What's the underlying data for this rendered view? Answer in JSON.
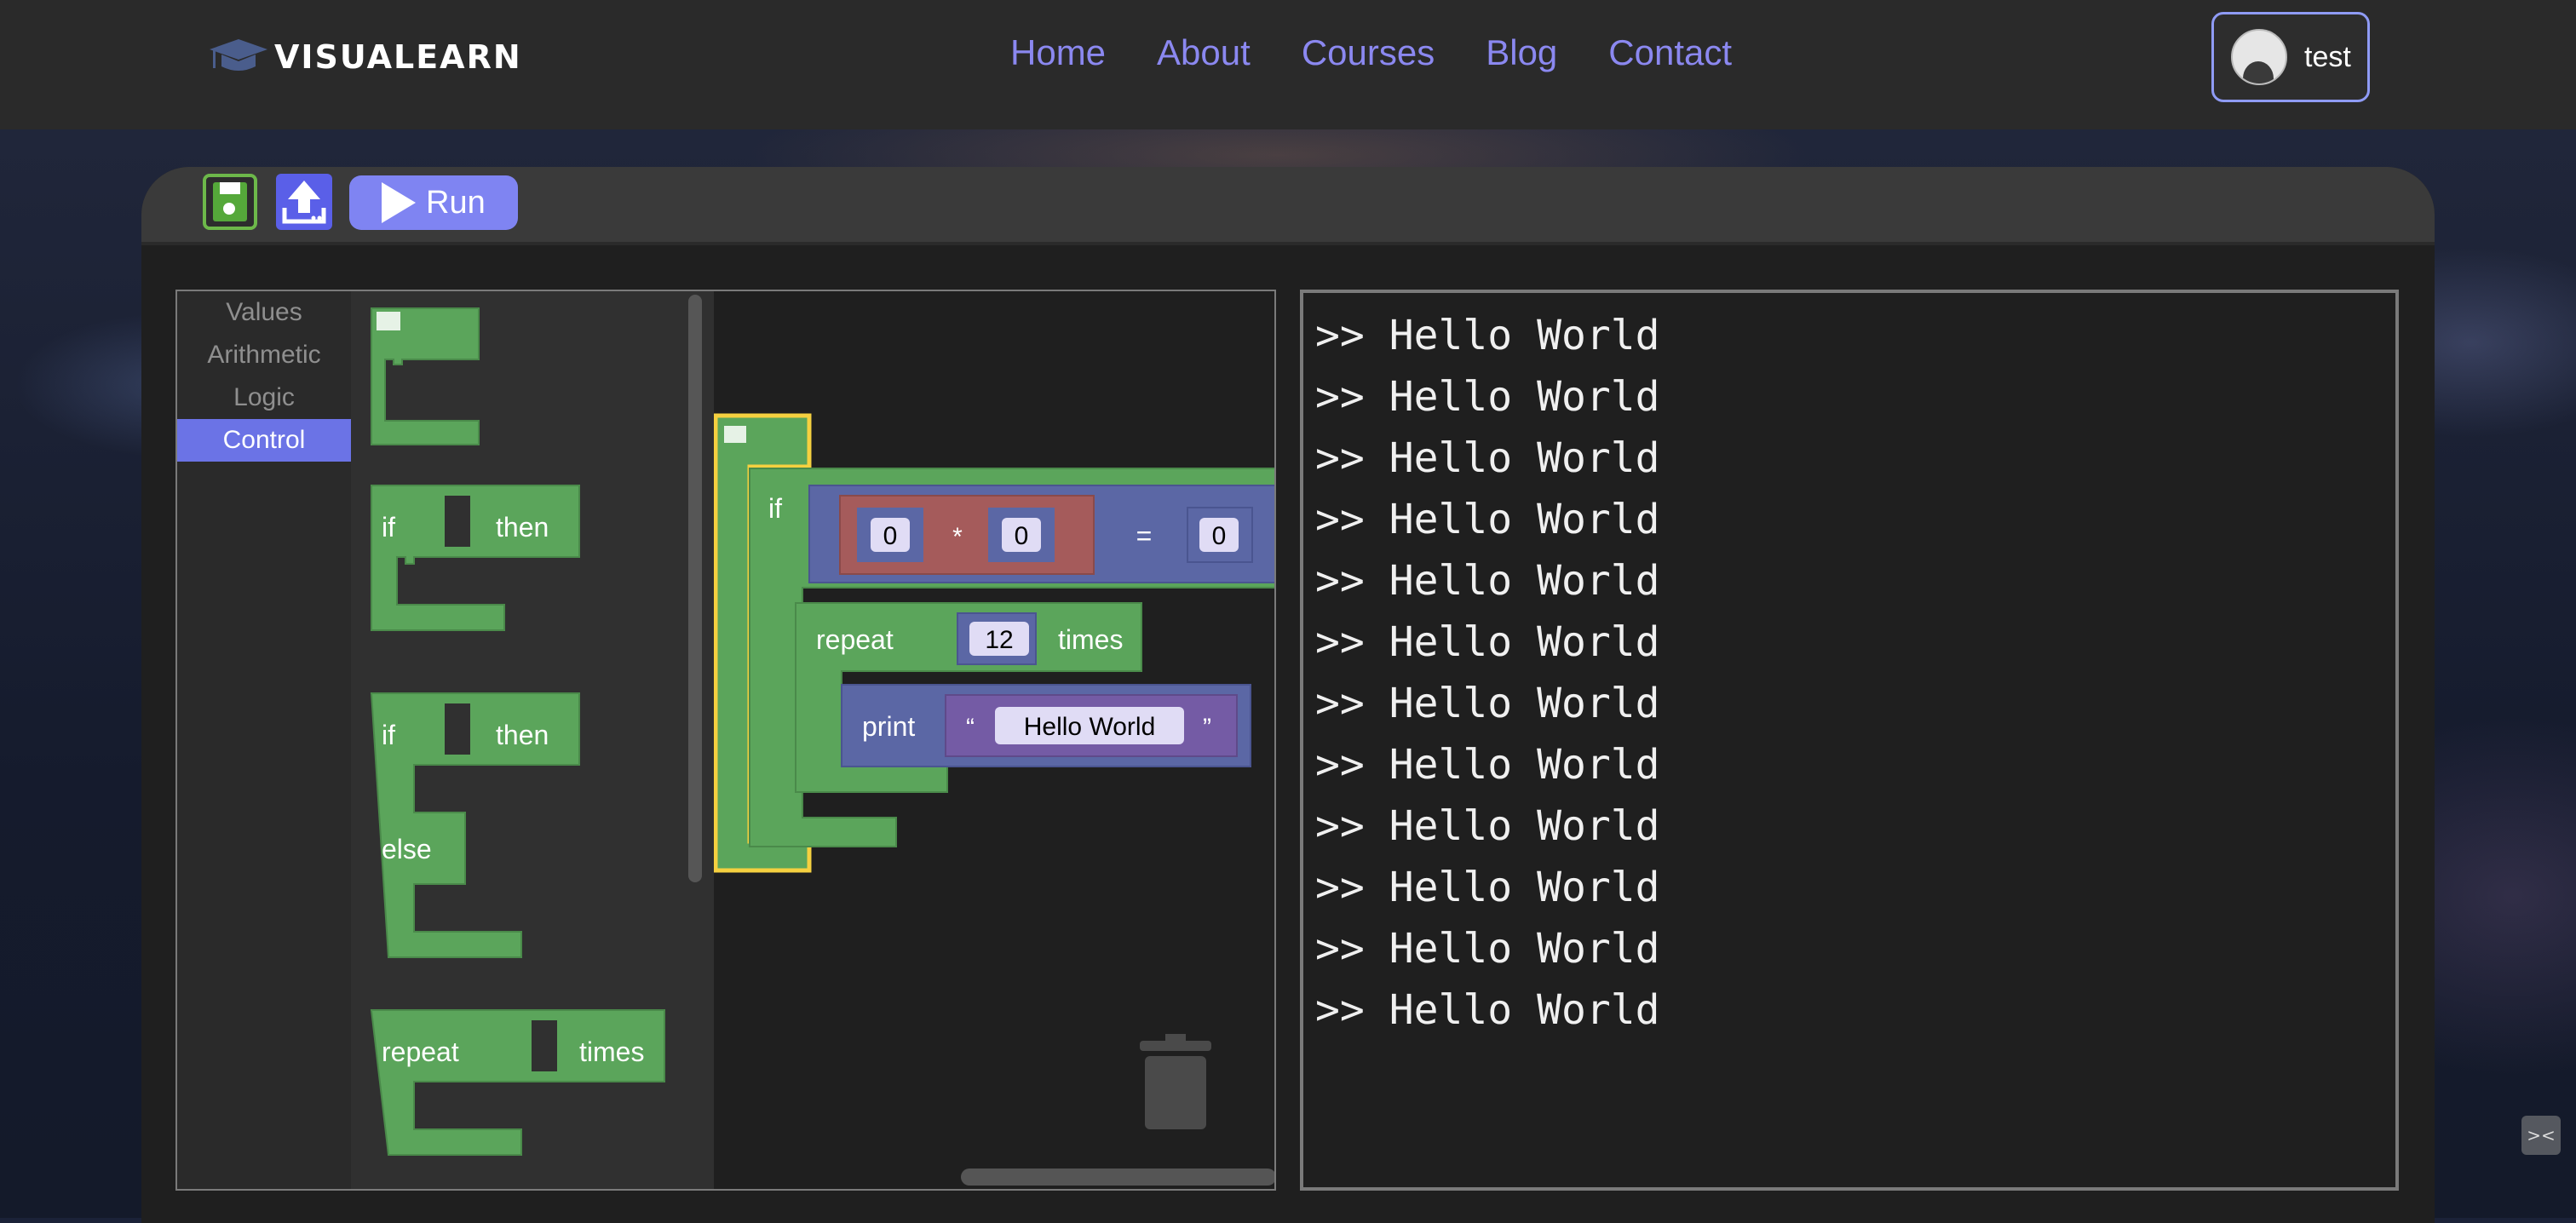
{
  "app": {
    "brand": "VISUALEARN"
  },
  "nav": {
    "items": [
      {
        "label": "Home"
      },
      {
        "label": "About"
      },
      {
        "label": "Courses"
      },
      {
        "label": "Blog"
      },
      {
        "label": "Contact"
      }
    ]
  },
  "user": {
    "name": "test"
  },
  "toolbar": {
    "run_label": "Run",
    "save_icon": "save-icon",
    "upload_icon": "upload-icon"
  },
  "categories": [
    {
      "label": "Values"
    },
    {
      "label": "Arithmetic"
    },
    {
      "label": "Logic"
    },
    {
      "label": "Control",
      "selected": true
    }
  ],
  "flyout": {
    "if_label": "if",
    "then_label": "then",
    "else_label": "else",
    "repeat_label": "repeat",
    "times_label": "times"
  },
  "program": {
    "if_label": "if",
    "left_a": "0",
    "op_mul": "*",
    "left_b": "0",
    "op_eq": "=",
    "right": "0",
    "repeat_label": "repeat",
    "repeat_count": "12",
    "times_label": "times",
    "print_label": "print",
    "quote_open": "“",
    "string_value": "Hello World",
    "quote_close": "”"
  },
  "console": {
    "lines": [
      ">> Hello World",
      ">> Hello World",
      ">> Hello World",
      ">> Hello World",
      ">> Hello World",
      ">> Hello World",
      ">> Hello World",
      ">> Hello World",
      ">> Hello World",
      ">> Hello World",
      ">> Hello World",
      ">> Hello World"
    ]
  },
  "colors": {
    "accent": "#8b88f0",
    "control_block": "#5ba55b",
    "math_block": "#5b67a5",
    "arith_block": "#a55b5b",
    "text_block": "#745ba5"
  }
}
